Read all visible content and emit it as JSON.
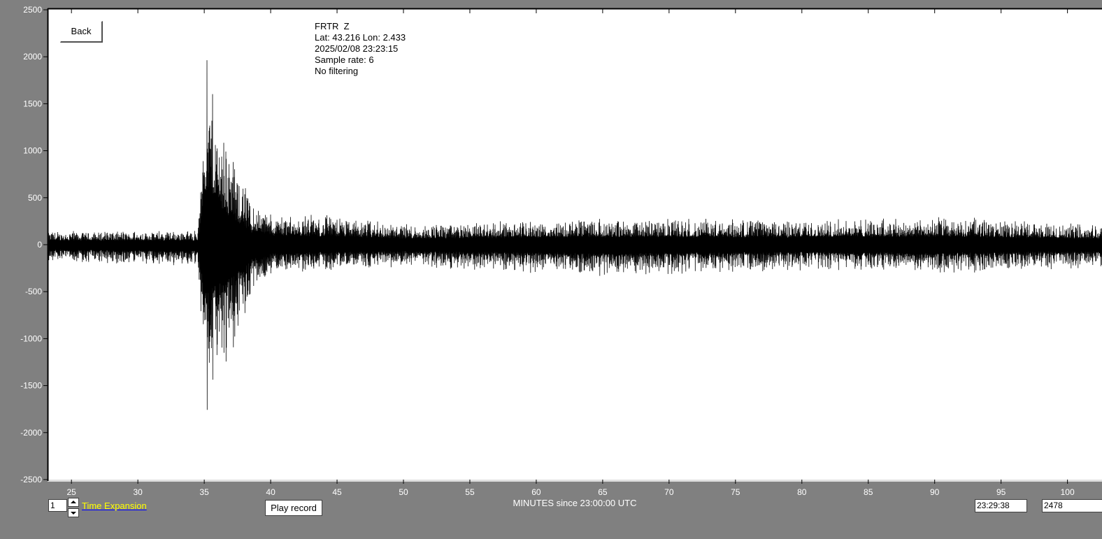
{
  "chart_data": {
    "type": "line",
    "info": {
      "station": "FRTR  Z",
      "location": "Lat: 43.216 Lon: 2.433",
      "datetime": "2025/02/08 23:23:15",
      "sample_rate": "Sample rate: 6",
      "filter": "No filtering"
    },
    "xlabel": "MINUTES since 23:00:00 UTC",
    "xlim": [
      23.2,
      102.6
    ],
    "ylim": [
      -2500,
      2500
    ],
    "xticks": [
      25,
      30,
      35,
      40,
      45,
      50,
      55,
      60,
      65,
      70,
      75,
      80,
      85,
      90,
      95,
      100
    ],
    "yticks": [
      2500,
      2000,
      1500,
      1000,
      500,
      0,
      -500,
      -1000,
      -1500,
      -2000,
      -2500
    ],
    "series": [
      {
        "envelope": [
          {
            "x": 23.2,
            "max": 150,
            "min": -180
          },
          {
            "x": 34.5,
            "max": 160,
            "min": -250
          },
          {
            "x": 34.7,
            "max": 550,
            "min": -600
          },
          {
            "x": 35.0,
            "max": 2130,
            "min": -2010
          },
          {
            "x": 35.6,
            "max": 1900,
            "min": -1550
          },
          {
            "x": 36.5,
            "max": 1250,
            "min": -1450
          },
          {
            "x": 37.5,
            "max": 880,
            "min": -1050
          },
          {
            "x": 38.5,
            "max": 500,
            "min": -600
          },
          {
            "x": 40.0,
            "max": 350,
            "min": -350
          },
          {
            "x": 45.0,
            "max": 320,
            "min": -270
          },
          {
            "x": 50.0,
            "max": 230,
            "min": -250
          },
          {
            "x": 66.0,
            "max": 290,
            "min": -340
          },
          {
            "x": 80.0,
            "max": 280,
            "min": -280
          },
          {
            "x": 90.0,
            "max": 310,
            "min": -320
          },
          {
            "x": 102.6,
            "max": 220,
            "min": -250
          }
        ]
      }
    ]
  },
  "controls": {
    "back_label": "Back",
    "expansion_value": "1",
    "expansion_label": "Time Expansion",
    "play_label": "Play record",
    "cursor_time": "23:29:38",
    "cursor_value": "2478"
  },
  "colors": {
    "background": "#808080",
    "plot_area": "#ffffff",
    "trace": "#000000",
    "axis_text": "#ffffff",
    "expansion_label": "#ffff00"
  }
}
